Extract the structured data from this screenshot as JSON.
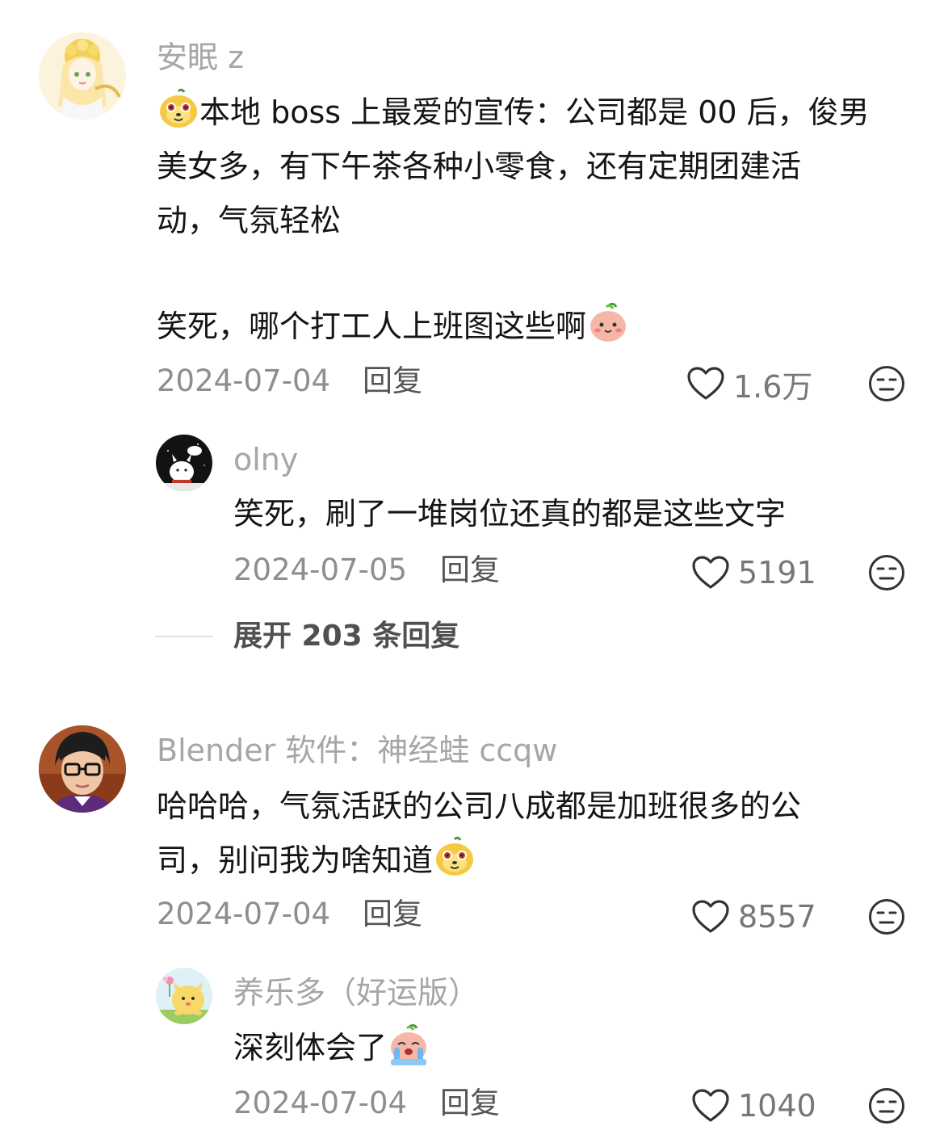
{
  "comments": [
    {
      "username": "安眠 z",
      "content": {
        "line1": "本地 boss 上最爱的宣传：公司都是 00 后，俊男",
        "line2": "美女多，有下午茶各种小零食，还有定期团建活",
        "line3": "动，气氛轻松",
        "line4": "笑死，哪个打工人上班图这些啊"
      },
      "emojis": [
        "dog-face-emoji",
        "blush-face-emoji"
      ],
      "date": "2024-07-04",
      "reply_label": "回复",
      "likes": "1.6万",
      "replies": [
        {
          "username": "olny",
          "content": "笑死，刷了一堆岗位还真的都是这些文字",
          "date": "2024-07-05",
          "reply_label": "回复",
          "likes": "5191"
        }
      ],
      "expand_label": "展开 203 条回复"
    },
    {
      "username": "Blender 软件：神经蛙 ccqw",
      "content": {
        "line1": "哈哈哈，气氛活跃的公司八成都是加班很多的公",
        "line2": "司，别问我为啥知道"
      },
      "emojis": [
        "dog-face-emoji"
      ],
      "date": "2024-07-04",
      "reply_label": "回复",
      "likes": "8557",
      "replies": [
        {
          "username": "养乐多（好运版）",
          "content": "深刻体会了",
          "emojis": [
            "crying-face-emoji"
          ],
          "date": "2024-07-04",
          "reply_label": "回复",
          "likes": "1040"
        }
      ]
    }
  ],
  "icons": {
    "like": "heart-outline-icon",
    "dislike": "meh-face-icon"
  },
  "colors": {
    "username": "#a6a6a6",
    "text": "#151515",
    "meta": "#8e8e8e",
    "emoji_yellow": "#f6c945",
    "emoji_pink": "#f4a99b"
  }
}
